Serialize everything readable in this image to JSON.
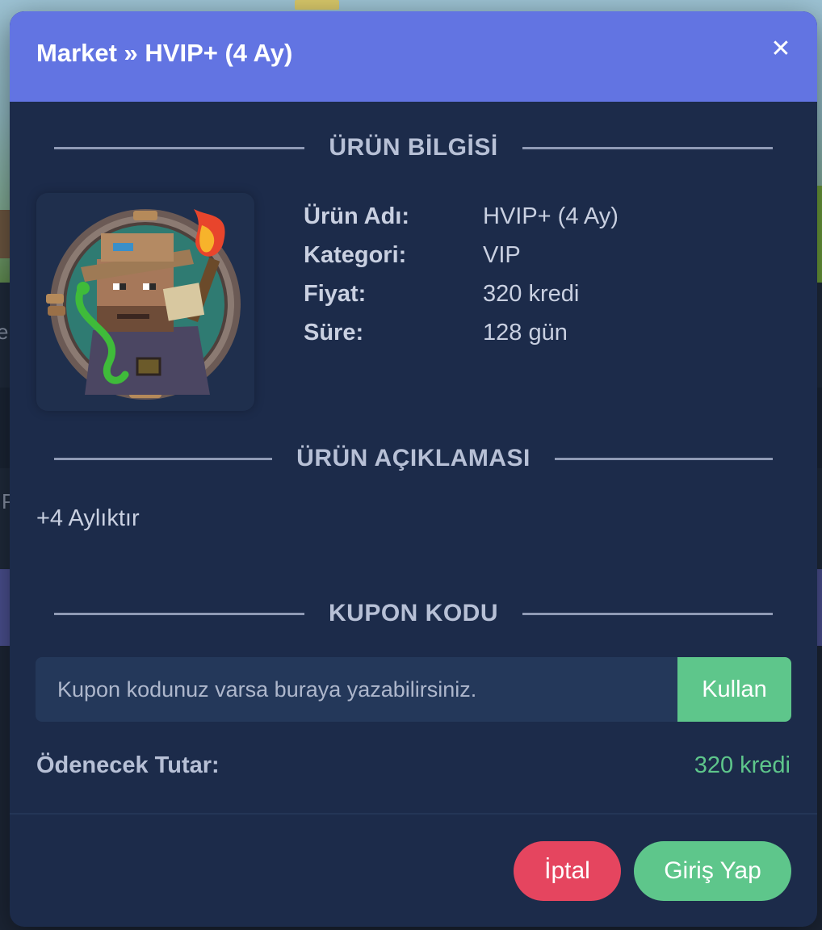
{
  "background": {
    "letter_left_1": "e",
    "letter_left_2": "P"
  },
  "modal": {
    "title": "Market » HVIP+ (4 Ay)",
    "close_icon": "close-icon",
    "header_color": "#6274e2"
  },
  "sections": {
    "product_info": "ÜRÜN BİLGİSİ",
    "product_description": "ÜRÜN AÇIKLAMASI",
    "coupon_code": "KUPON KODU"
  },
  "product": {
    "image_icon": "minecraft-explorer-avatar",
    "fields": [
      {
        "label": "Ürün Adı:",
        "value": "HVIP+ (4 Ay)"
      },
      {
        "label": "Kategori:",
        "value": "VIP"
      },
      {
        "label": "Fiyat:",
        "value": "320 kredi"
      },
      {
        "label": "Süre:",
        "value": "128 gün"
      }
    ],
    "description": "+4 Aylıktır"
  },
  "coupon": {
    "placeholder": "Kupon kodunuz varsa buraya yazabilirsiniz.",
    "value": "",
    "apply_label": "Kullan"
  },
  "total": {
    "label": "Ödenecek Tutar:",
    "value": "320 kredi"
  },
  "actions": {
    "cancel_label": "İptal",
    "login_label": "Giriş Yap"
  },
  "colors": {
    "accent": "#6274e2",
    "success": "#5ec68b",
    "danger": "#e5455f",
    "modal_bg": "#1c2b4a"
  }
}
